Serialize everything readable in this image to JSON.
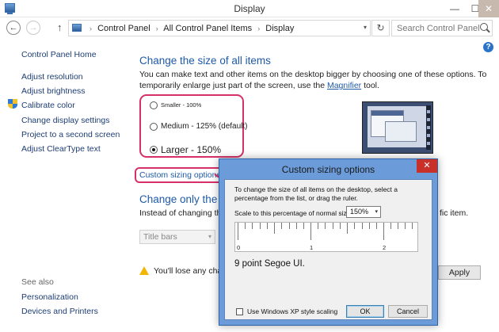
{
  "window": {
    "title": "Display",
    "min_glyph": "—",
    "max_glyph": "☐",
    "close_glyph": "✕"
  },
  "nav": {
    "back_glyph": "←",
    "forward_glyph": "→",
    "up_glyph": "↑",
    "refresh_glyph": "↻",
    "dropdown_glyph": "▾",
    "breadcrumb": [
      "Control Panel",
      "All Control Panel Items",
      "Display"
    ],
    "crumb_separator": "›",
    "search_placeholder": "Search Control Panel"
  },
  "help_glyph": "?",
  "sidebar": {
    "home": "Control Panel Home",
    "links": [
      "Adjust resolution",
      "Adjust brightness",
      "Calibrate color",
      "Change display settings",
      "Project to a second screen",
      "Adjust ClearType text"
    ],
    "see_also_heading": "See also",
    "see_also": [
      "Personalization",
      "Devices and Printers"
    ]
  },
  "main": {
    "heading": "Change the size of all items",
    "intro_before": "You can make text and other items on the desktop bigger by choosing one of these options. To temporarily enlarge just part of the screen, use the ",
    "intro_link": "Magnifier",
    "intro_after": " tool.",
    "options": [
      {
        "label": "Smaller - 100%",
        "selected": false
      },
      {
        "label": "Medium - 125% (default)",
        "selected": false
      },
      {
        "label": "Larger - 150%",
        "selected": true
      }
    ],
    "custom_link": "Custom sizing options",
    "heading2": "Change only the te",
    "heading2_sub": "Instead of changing the s",
    "heading2_tail": "fic item.",
    "item_select": "Title bars",
    "warning": "You'll lose any chang",
    "apply": "Apply"
  },
  "dialog": {
    "title": "Custom sizing options",
    "close_glyph": "✕",
    "description": "To change the size of all items on the desktop, select a percentage from the list, or drag the ruler.",
    "scale_label": "Scale to this percentage of normal size:",
    "scale_value": "150%",
    "ruler_labels": [
      "0",
      "1",
      "2"
    ],
    "preview_text": "9 point Segoe UI.",
    "checkbox_label": "Use Windows XP style scaling",
    "checkbox_checked": false,
    "ok": "OK",
    "cancel": "Cancel"
  },
  "colors": {
    "highlight": "#d6306b",
    "link": "#1e5aa8",
    "dialog_frame": "#6b9bd8"
  }
}
